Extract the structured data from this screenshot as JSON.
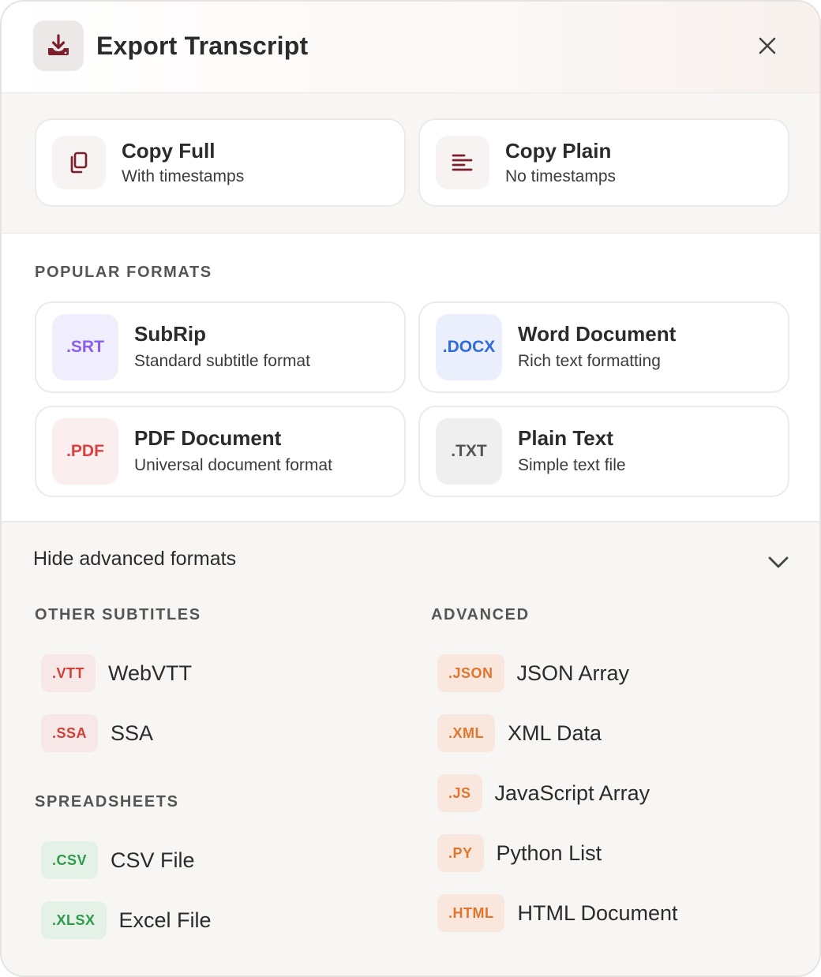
{
  "header": {
    "title": "Export Transcript",
    "icon": "download-icon",
    "close_icon": "close-icon"
  },
  "copy": [
    {
      "title": "Copy Full",
      "subtitle": "With timestamps",
      "icon": "copy-icon"
    },
    {
      "title": "Copy Plain",
      "subtitle": "No timestamps",
      "icon": "align-left-icon"
    }
  ],
  "popular": {
    "label": "POPULAR FORMATS",
    "formats": [
      {
        "badge": ".SRT",
        "title": "SubRip",
        "subtitle": "Standard subtitle format",
        "color": "#8a5cf0",
        "bg": "#f0eefc"
      },
      {
        "badge": ".DOCX",
        "title": "Word Document",
        "subtitle": "Rich text formatting",
        "color": "#2f6bdc",
        "bg": "#eaeffb"
      },
      {
        "badge": ".PDF",
        "title": "PDF Document",
        "subtitle": "Universal document format",
        "color": "#d94040",
        "bg": "#fbeeee"
      },
      {
        "badge": ".TXT",
        "title": "Plain Text",
        "subtitle": "Simple text file",
        "color": "#555555",
        "bg": "#efefef"
      }
    ]
  },
  "advanced": {
    "toggle_label": "Hide advanced formats",
    "other_subtitles": {
      "label": "OTHER SUBTITLES",
      "items": [
        {
          "tag": ".VTT",
          "name": "WebVTT"
        },
        {
          "tag": ".SSA",
          "name": "SSA"
        }
      ]
    },
    "spreadsheets": {
      "label": "SPREADSHEETS",
      "items": [
        {
          "tag": ".CSV",
          "name": "CSV File"
        },
        {
          "tag": ".XLSX",
          "name": "Excel File"
        }
      ]
    },
    "advanced_group": {
      "label": "ADVANCED",
      "items": [
        {
          "tag": ".JSON",
          "name": "JSON Array"
        },
        {
          "tag": ".XML",
          "name": "XML Data"
        },
        {
          "tag": ".JS",
          "name": "JavaScript Array"
        },
        {
          "tag": ".PY",
          "name": "Python List"
        },
        {
          "tag": ".HTML",
          "name": "HTML Document"
        }
      ]
    }
  },
  "colors": {
    "accent": "#7a1f2b"
  }
}
